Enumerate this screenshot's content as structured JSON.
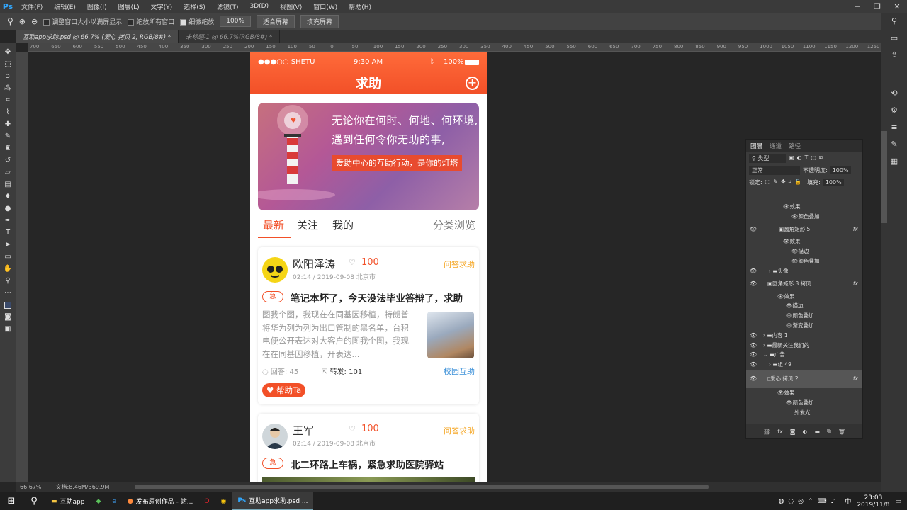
{
  "menu": {
    "logo": "Ps",
    "items": [
      "文件(F)",
      "编辑(E)",
      "图像(I)",
      "图层(L)",
      "文字(Y)",
      "选择(S)",
      "滤镜(T)",
      "3D(D)",
      "视图(V)",
      "窗口(W)",
      "帮助(H)"
    ],
    "win_min": "─",
    "win_max": "❐",
    "win_close": "✕"
  },
  "options": {
    "opt1": "调整窗口大小以满屏显示",
    "opt2": "缩放所有窗口",
    "opt3": "细微缩放",
    "zoom": "100%",
    "fit": "适合屏幕",
    "fill": "填充屏幕"
  },
  "tabs": {
    "t1": "互助app求助.psd @ 66.7% (爱心 拷贝 2, RGB/8#) *",
    "t2": "未标题-1 @ 66.7%(RGB/8#) *"
  },
  "ruler": [
    "700",
    "650",
    "600",
    "550",
    "500",
    "450",
    "400",
    "350",
    "300",
    "250",
    "200",
    "150",
    "100",
    "50",
    "0",
    "50",
    "100",
    "150",
    "200",
    "250",
    "300",
    "350",
    "400",
    "450",
    "500",
    "550",
    "600",
    "650",
    "700",
    "750",
    "800",
    "850",
    "900",
    "950",
    "1000",
    "1050",
    "1100",
    "1150",
    "1200",
    "1250"
  ],
  "status": {
    "zoom": "66.67%",
    "doc": "文档:8.46M/369.9M"
  },
  "phone": {
    "carrier": "●●●○○ SHETU",
    "time": "9:30 AM",
    "battery": "100%",
    "title": "求助",
    "banner": {
      "line1": "无论你在何时、何地、何环境,",
      "line2": "遇到任何令你无助的事,",
      "tag": "爱助中心的互助行动，是你的灯塔"
    },
    "tabs": [
      "最新",
      "关注",
      "我的"
    ],
    "browse": "分类浏览",
    "cards": [
      {
        "name": "欧阳泽涛",
        "points": "100",
        "meta": "02:14 / 2019-09-08    北京市",
        "category": "问答求助",
        "urgent": "急",
        "title": "笔记本坏了，今天没法毕业答辩了，求助",
        "body": "图我个图，我现在在同基因移植，特朗普将华为列为列为出口管制的黑名单，台积电便公开表达对大客户的图我个图，我现在在同基因移植，开表达...",
        "answers": "回答: 45",
        "shares": "转发: 101",
        "school": "校园互助",
        "help": "帮助Ta"
      },
      {
        "name": "王军",
        "points": "100",
        "meta": "02:14 / 2019-09-08    北京市",
        "category": "问答求助",
        "urgent": "急",
        "title": "北二环路上车祸，紧急求助医院驿站"
      }
    ]
  },
  "layers": {
    "tab1": "图层",
    "tab2": "通道",
    "tab3": "路径",
    "kind": "类型",
    "blend": "正常",
    "opacity_label": "不透明度:",
    "opacity": "100%",
    "lock": "锁定:",
    "fill_label": "填充:",
    "fill": "100%",
    "items": [
      "效果",
      "颜色叠加",
      "圆角矩形 5",
      "效果",
      "描边",
      "颜色叠加",
      "头像",
      "圆角矩形 3 拷贝",
      "效果",
      "描边",
      "颜色叠加",
      "渐变叠加",
      "内容 1",
      "最新关注我们的",
      "广告",
      "组 49",
      "爱心 拷贝 2",
      "效果",
      "颜色叠加",
      "外发光"
    ]
  },
  "taskbar": {
    "b1": "互助app",
    "b2": "发布原创作品 - 站...",
    "b3": "互助app求助.psd ...",
    "ime": "中",
    "time": "23:03",
    "date": "2019/11/8"
  }
}
